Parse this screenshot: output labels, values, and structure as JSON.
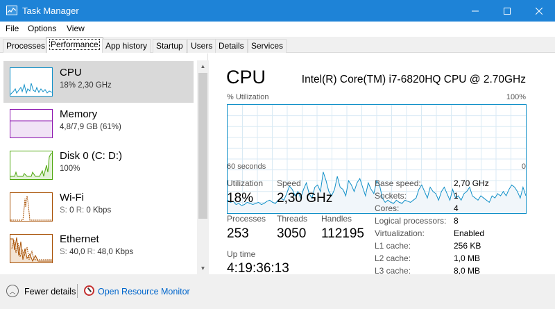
{
  "window": {
    "title": "Task Manager",
    "minimize_icon": "minimize-icon",
    "maximize_icon": "maximize-icon",
    "close_icon": "close-icon"
  },
  "menu": [
    "File",
    "Options",
    "View"
  ],
  "tabs": [
    {
      "label": "Processes",
      "active": false
    },
    {
      "label": "Performance",
      "active": true
    },
    {
      "label": "App history",
      "active": false
    },
    {
      "label": "Startup",
      "active": false
    },
    {
      "label": "Users",
      "active": false
    },
    {
      "label": "Details",
      "active": false
    },
    {
      "label": "Services",
      "active": false
    }
  ],
  "sidebar": {
    "items": [
      {
        "name": "CPU",
        "sub1": "18% 2,30 GHz",
        "color": "#1190c8",
        "selected": true
      },
      {
        "name": "Memory",
        "sub1": "4,8/7,9 GB (61%)",
        "color": "#8b12ae",
        "selected": false
      },
      {
        "name": "Disk 0 (C: D:)",
        "sub1": "100%",
        "color": "#4da60c",
        "selected": false
      },
      {
        "name": "Wi-Fi",
        "sub_prefix1": "S:",
        "sub_val1": "0",
        "sub_prefix2": "R:",
        "sub_val2": "0 Kbps",
        "color": "#a74f01",
        "selected": false
      },
      {
        "name": "Ethernet",
        "sub_prefix1": "S:",
        "sub_val1": "40,0",
        "sub_prefix2": "R:",
        "sub_val2": "48,0 Kbps",
        "color": "#a74f01",
        "selected": false
      }
    ]
  },
  "main": {
    "title": "CPU",
    "model": "Intel(R) Core(TM) i7-6820HQ CPU @ 2.70GHz",
    "graph": {
      "label": "% Utilization",
      "max": "100%",
      "time_left": "60 seconds",
      "time_right": "0",
      "line_color": "#1190c8",
      "series": [
        12,
        10,
        11,
        8,
        9,
        7,
        8,
        10,
        9,
        8,
        9,
        10,
        8,
        9,
        11,
        12,
        10,
        9,
        12,
        14,
        12,
        18,
        25,
        22,
        16,
        20,
        14,
        22,
        28,
        18,
        14,
        24,
        26,
        20,
        38,
        30,
        20,
        16,
        22,
        34,
        24,
        22,
        16,
        30,
        26,
        20,
        28,
        32,
        24,
        16,
        28,
        22,
        18,
        30,
        26,
        14,
        10,
        12,
        10,
        9,
        12,
        10,
        9,
        12,
        11,
        10,
        12,
        14,
        22,
        26,
        20,
        14,
        24,
        20,
        18,
        12,
        20,
        24,
        18,
        12,
        22,
        14,
        16,
        12,
        18,
        20,
        24,
        16,
        14,
        12,
        16,
        14,
        12,
        10,
        16,
        14,
        18,
        16,
        20,
        16,
        22,
        26,
        24,
        20,
        14,
        24,
        16
      ]
    },
    "stats": [
      {
        "label": "Utilization",
        "value": "18%"
      },
      {
        "label": "Speed",
        "value": "2,30 GHz"
      },
      {
        "label": "Processes",
        "value": "253"
      },
      {
        "label": "Threads",
        "value": "3050"
      },
      {
        "label": "Handles",
        "value": "112195"
      },
      {
        "label": "Up time",
        "value": "4:19:36:13"
      }
    ],
    "specs": [
      {
        "label": "Base speed:",
        "value": "2,70 GHz"
      },
      {
        "label": "Sockets:",
        "value": "1"
      },
      {
        "label": "Cores:",
        "value": "4"
      },
      {
        "label": "Logical processors:",
        "value": "8"
      },
      {
        "label": "Virtualization:",
        "value": "Enabled"
      },
      {
        "label": "L1 cache:",
        "value": "256 KB"
      },
      {
        "label": "L2 cache:",
        "value": "1,0 MB"
      },
      {
        "label": "L3 cache:",
        "value": "8,0 MB"
      }
    ]
  },
  "footer": {
    "fewer_details": "Fewer details",
    "resource_monitor": "Open Resource Monitor"
  }
}
